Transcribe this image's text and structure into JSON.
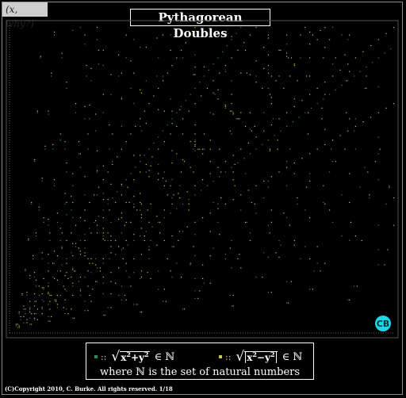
{
  "corner_tag": "(x, why?)",
  "title": "Pythagorean Doubles",
  "legend": {
    "sum_label": "√(x²+y²) ∈ ℕ",
    "diff_label": "√|x²−y²| ∈ ℕ",
    "elem_symbol": "∈ ℕ",
    "separator": "::",
    "note": "where ℕ is the set of natural numbers"
  },
  "logo_text": "CB",
  "copyright": "(C)Copyright 2010, C. Burke. All rights reserved. 1/18",
  "colors": {
    "sum": "#2e8b57",
    "diff": "#c8c83c",
    "background": "#000000",
    "frame": "#8a8a8a"
  },
  "chart_data": {
    "type": "scatter",
    "xlim": [
      0,
      1000
    ],
    "ylim": [
      0,
      800
    ],
    "grid": false,
    "legend_position": "bottom",
    "series": [
      {
        "name": "√(x²+y²) ∈ ℕ",
        "color": "#2e8b57",
        "generated": "integer pairs (x,y) in range where x²+y² is a perfect square"
      },
      {
        "name": "√|x²−y²| ∈ ℕ",
        "color": "#c8c83c",
        "generated": "integer pairs (x,y) in range where |x²−y²| is a perfect square"
      }
    ]
  }
}
